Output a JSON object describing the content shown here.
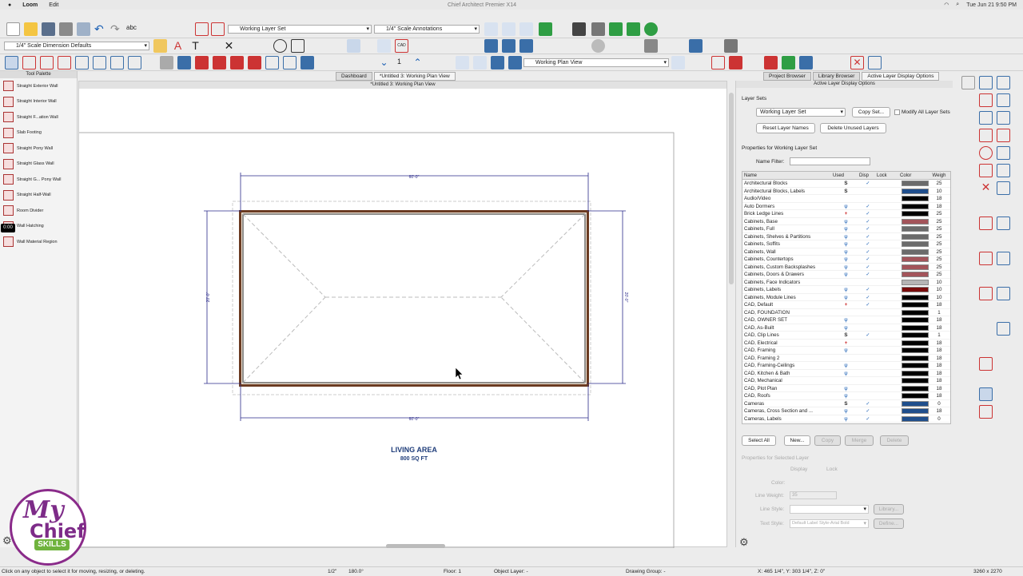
{
  "menubar": {
    "app": "Loom",
    "edit": "Edit",
    "window_title": "Chief Architect Premier X14",
    "clock": "Tue Jun 21  9:50 PM"
  },
  "toolbar": {
    "layer_set": "Working Layer Set",
    "annotation_set": "1/4\" Scale Annotations",
    "dimension_defaults": "1/4\" Scale Dimension Defaults",
    "floor_number": "1",
    "plan_view": "Working Plan View"
  },
  "tabs": {
    "project_browser": "Project Browser",
    "library_browser": "Library Browser",
    "active_layer_display": "Active Layer Display Options",
    "dashboard": "Dashboard",
    "doc_tab": "*Untitled 3:   Working Plan View"
  },
  "palette": {
    "title": "Tool Palette",
    "items": [
      "Straight Exterior Wall",
      "Straight Interior Wall",
      "Straight F...ation Wall",
      "Slab Footing",
      "Straight Pony Wall",
      "Straight Glass Wall",
      "Straight G... Pony Wall",
      "Straight Half-Wall",
      "Room Divider",
      "Wall Hatching",
      "Wall Material Region"
    ],
    "timer": "0:00"
  },
  "canvas": {
    "title": "*Untitled 3:   Working Plan View",
    "dim_top": "60'-0\"",
    "dim_bottom": "60'-0\"",
    "dim_left": "20'-0\"",
    "dim_right": "20'-0\"",
    "room_name": "LIVING AREA",
    "room_area": "800 SQ FT"
  },
  "panel": {
    "title": "Active Layer Display Options",
    "layer_sets_label": "Layer Sets",
    "layer_set_value": "Working Layer Set",
    "copy_set": "Copy Set...",
    "modify_all": "Modify All Layer Sets",
    "reset_names": "Reset Layer Names",
    "delete_unused": "Delete Unused Layers",
    "properties_for": "Properties for  Working Layer Set",
    "name_filter": "Name Filter:",
    "columns": {
      "name": "Name",
      "used": "Used",
      "disp": "Disp",
      "lock": "Lock",
      "color": "Color",
      "weight": "Weigh"
    },
    "select_all": "Select All",
    "new": "New...",
    "copy": "Copy",
    "merge": "Merge",
    "delete": "Delete",
    "props_selected": "Properties for Selected Layer",
    "display": "Display",
    "lock": "Lock",
    "color": "Color:",
    "line_weight": "Line Weight:",
    "line_weight_value": "35",
    "line_style": "Line Style:",
    "library": "Library...",
    "text_style": "Text Style:",
    "text_style_value": "Default Label Style-Arial Bold",
    "define": "Define..."
  },
  "layers": [
    {
      "name": "Architectural Blocks",
      "used": "S",
      "disp": "✓",
      "color": "#6b6b6b",
      "w": "25"
    },
    {
      "name": "Architectural Blocks, Labels",
      "used": "S",
      "disp": "",
      "color": "#1f4e8c",
      "w": "10"
    },
    {
      "name": "Audio/Video",
      "used": "",
      "disp": "",
      "color": "#000000",
      "w": "18"
    },
    {
      "name": "Auto Dormers",
      "used": "ψ",
      "disp": "✓",
      "color": "#000000",
      "w": "18"
    },
    {
      "name": "Brick Ledge Lines",
      "used": "+",
      "disp": "✓",
      "color": "#000000",
      "w": "25"
    },
    {
      "name": "Cabinets,  Base",
      "used": "ψ",
      "disp": "✓",
      "color": "#a3545a",
      "w": "25"
    },
    {
      "name": "Cabinets,  Full",
      "used": "ψ",
      "disp": "✓",
      "color": "#6b6b6b",
      "w": "25"
    },
    {
      "name": "Cabinets,  Shelves & Partitions",
      "used": "ψ",
      "disp": "✓",
      "color": "#6b6b6b",
      "w": "25"
    },
    {
      "name": "Cabinets,  Soffits",
      "used": "ψ",
      "disp": "✓",
      "color": "#6b6b6b",
      "w": "25"
    },
    {
      "name": "Cabinets,  Wall",
      "used": "ψ",
      "disp": "✓",
      "color": "#6b6b6b",
      "w": "25"
    },
    {
      "name": "Cabinets, Countertops",
      "used": "ψ",
      "disp": "✓",
      "color": "#a3545a",
      "w": "25"
    },
    {
      "name": "Cabinets, Custom Backsplashes",
      "used": "ψ",
      "disp": "✓",
      "color": "#a3545a",
      "w": "25"
    },
    {
      "name": "Cabinets, Doors & Drawers",
      "used": "ψ",
      "disp": "✓",
      "color": "#a3545a",
      "w": "25"
    },
    {
      "name": "Cabinets, Face Indicators",
      "used": "",
      "disp": "",
      "color": "#b5b5b5",
      "w": "10"
    },
    {
      "name": "Cabinets, Labels",
      "used": "ψ",
      "disp": "✓",
      "color": "#7a0d0d",
      "w": "10"
    },
    {
      "name": "Cabinets, Module Lines",
      "used": "ψ",
      "disp": "✓",
      "color": "#000000",
      "w": "10"
    },
    {
      "name": "CAD,  Default",
      "used": "+",
      "disp": "✓",
      "color": "#000000",
      "w": "18"
    },
    {
      "name": "CAD,  FOUNDATION",
      "used": "",
      "disp": "",
      "color": "#000000",
      "w": "1"
    },
    {
      "name": "CAD,  OWNER SET",
      "used": "ψ",
      "disp": "",
      "color": "#000000",
      "w": "18"
    },
    {
      "name": "CAD, As-Built",
      "used": "ψ",
      "disp": "",
      "color": "#000000",
      "w": "18"
    },
    {
      "name": "CAD, Clip Lines",
      "used": "S",
      "disp": "✓",
      "color": "#000000",
      "w": "1"
    },
    {
      "name": "CAD, Electrical",
      "used": "+",
      "disp": "",
      "color": "#000000",
      "w": "18"
    },
    {
      "name": "CAD, Framing",
      "used": "ψ",
      "disp": "",
      "color": "#000000",
      "w": "18"
    },
    {
      "name": "CAD, Framing 2",
      "used": "",
      "disp": "",
      "color": "#000000",
      "w": "18"
    },
    {
      "name": "CAD, Framing-Ceilings",
      "used": "ψ",
      "disp": "",
      "color": "#000000",
      "w": "18"
    },
    {
      "name": "CAD, Kitchen & Bath",
      "used": "ψ",
      "disp": "",
      "color": "#000000",
      "w": "18"
    },
    {
      "name": "CAD, Mechanical",
      "used": "",
      "disp": "",
      "color": "#000000",
      "w": "18"
    },
    {
      "name": "CAD, Plot Plan",
      "used": "ψ",
      "disp": "",
      "color": "#000000",
      "w": "18"
    },
    {
      "name": "CAD, Roofs",
      "used": "ψ",
      "disp": "",
      "color": "#000000",
      "w": "18"
    },
    {
      "name": "Cameras",
      "used": "S",
      "disp": "✓",
      "color": "#1f4e8c",
      "w": "0"
    },
    {
      "name": "Cameras, Cross Section and ...",
      "used": "ψ",
      "disp": "✓",
      "color": "#1f4e8c",
      "w": "18"
    },
    {
      "name": "Cameras, Labels",
      "used": "ψ",
      "disp": "✓",
      "color": "#1f4e8c",
      "w": "0"
    }
  ],
  "status": {
    "hint": "Click on any object to select it for moving, resizing, or deleting.",
    "scale": "1/2\"",
    "angle": "180.0°",
    "floor": "Floor: 1",
    "object_layer": "Object Layer: -",
    "drawing_group": "Drawing Group: -",
    "coords": "X: 465 1/4\", Y: 303 1/4\", Z: 0\"",
    "size": "3260 x 2270"
  },
  "logo": {
    "my": "My",
    "chief": "Chief",
    "skills": "SKILLS"
  }
}
